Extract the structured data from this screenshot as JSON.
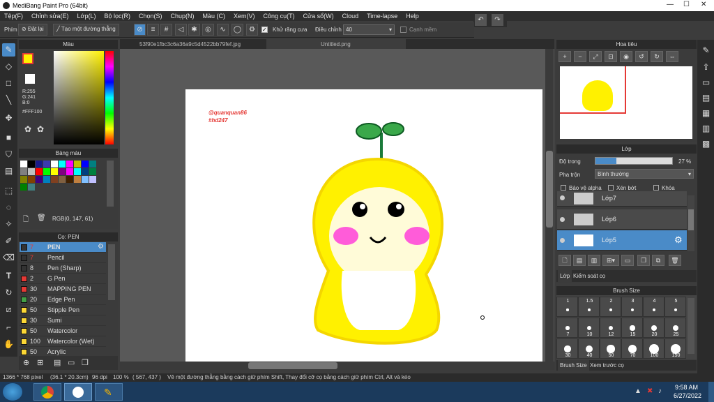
{
  "window": {
    "title": "MediBang Paint Pro (64bit)"
  },
  "menu": [
    "Tệp(F)",
    "Chỉnh sửa(E)",
    "Lớp(L)",
    "Bộ lọc(R)",
    "Chọn(S)",
    "Chụp(N)",
    "Màu (C)",
    "Xem(V)",
    "Công cụ(T)",
    "Cửa sổ(W)",
    "Cloud",
    "Time-lapse",
    "Help"
  ],
  "toolbar": {
    "phim": "Phím",
    "reset": "Đặt lại",
    "straight": "Tạo một đường thẳng",
    "antialias": "Khử răng cưa",
    "adjust": "Điều chỉnh",
    "adjust_value": "40",
    "edge": "Cạnh mềm"
  },
  "tabs": [
    "53f90e1fbc3c6a36a9c5d4522bb79fef.jpg",
    "Untitled.png"
  ],
  "color_panel": {
    "title": "Màu",
    "r": "R:255",
    "g": "G:241",
    "b": "B:0",
    "hex": "#FFF100"
  },
  "palette": {
    "title": "Bảng màu",
    "rgb": "RGB(0, 147, 61)"
  },
  "brush_panel": {
    "title": "Cọ: PEN",
    "items": [
      {
        "n": "7",
        "label": "PEN",
        "color": "#333333"
      },
      {
        "n": "7",
        "label": "Pencil",
        "color": "#333333"
      },
      {
        "n": "8",
        "label": "Pen (Sharp)",
        "color": "#333333"
      },
      {
        "n": "2",
        "label": "G Pen",
        "color": "#e53935"
      },
      {
        "n": "30",
        "label": "MAPPING PEN",
        "color": "#e53935"
      },
      {
        "n": "20",
        "label": "Edge Pen",
        "color": "#43a047"
      },
      {
        "n": "50",
        "label": "Stipple Pen",
        "color": "#fdd835"
      },
      {
        "n": "30",
        "label": "Sumi",
        "color": "#fdd835"
      },
      {
        "n": "50",
        "label": "Watercolor",
        "color": "#fdd835"
      },
      {
        "n": "100",
        "label": "Watercolor (Wet)",
        "color": "#fdd835"
      },
      {
        "n": "50",
        "label": "Acrylic",
        "color": "#fdd835"
      }
    ]
  },
  "canvas": {
    "watermark1": "@quanquan86",
    "watermark2": "#hd247"
  },
  "navigator": {
    "title": "Hoa tiêu"
  },
  "layers": {
    "title": "Lớp",
    "opacity_label": "Độ trong",
    "opacity": "27 %",
    "opacity_value": 0.27,
    "blend_label": "Pha trộn",
    "blend": "Bình thường",
    "protect_alpha": "Bảo vệ alpha",
    "clip": "Xén bớt",
    "lock": "Khóa",
    "items": [
      "Lớp7",
      "Lớp6",
      "Lớp5"
    ],
    "tab1": "Lớp",
    "tab2": "Kiểm soát cọ"
  },
  "brush_size": {
    "title": "Brush Size",
    "values": [
      "1",
      "1.5",
      "2",
      "3",
      "4",
      "5",
      "7",
      "10",
      "12",
      "15",
      "20",
      "25",
      "30",
      "40",
      "50",
      "70",
      "100",
      "150"
    ],
    "tab1": "Brush Size",
    "tab2": "Xem trước cọ"
  },
  "status": {
    "dims": "1366 * 768 pixel",
    "cm": "(36.1 * 20.3cm)",
    "dpi": "96 dpi",
    "zoom": "100 %",
    "pos": "( 567, 437 )",
    "hint": "Vẽ một đường thẳng bằng cách giữ phím Shift, Thay đổi cỡ cọ bằng cách giữ phím Ctrl, Alt và kéo"
  },
  "clock": {
    "time": "9:58 AM",
    "date": "6/27/2022"
  }
}
